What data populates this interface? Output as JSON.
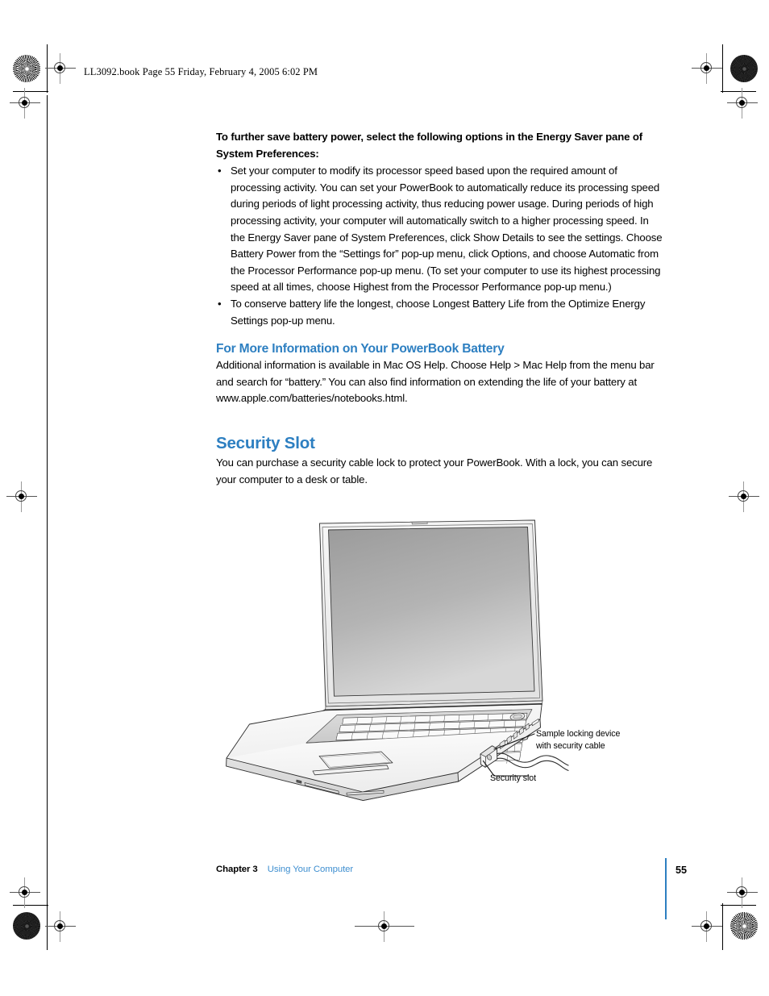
{
  "slug": {
    "text": "LL3092.book  Page 55  Friday, February 4, 2005  6:02 PM"
  },
  "content": {
    "lead_paragraph": "To further save battery power, select the following options in the Energy Saver pane of System Preferences:",
    "bullet_marker": "•",
    "bullets": [
      "Set your computer to modify its processor speed based upon the required amount of processing activity. You can set your PowerBook to automatically reduce its processing speed during periods of light processing activity, thus reducing power usage. During periods of high processing activity, your computer will automatically switch to a higher processing speed. In the Energy Saver pane of System Preferences, click Show Details to see the settings. Choose Battery Power from the “Settings for” pop-up menu, click Options, and choose Automatic from the Processor Performance pop-up menu. (To set your computer to use its highest processing speed at all times, choose Highest from the Processor Performance pop-up menu.)",
      "To conserve battery life the longest, choose Longest Battery Life from the Optimize Energy Settings pop-up menu."
    ],
    "subhead": "For More Information on Your PowerBook Battery",
    "subhead_body": "Additional information is available in Mac OS Help. Choose Help > Mac Help from the menu bar and search for “battery.” You can also find information on extending the life of your battery at www.apple.com/batteries/notebooks.html.",
    "section_heading": "Security Slot",
    "section_body": "You can purchase a security cable lock to protect your PowerBook. With a lock, you can secure your computer to a desk or table."
  },
  "figure": {
    "callout_lock_line1": "Sample locking device",
    "callout_lock_line2": "with security cable",
    "callout_slot": "Security slot"
  },
  "footer": {
    "chapter": "Chapter 3",
    "chapter_title": "Using Your Computer",
    "page_number": "55"
  },
  "colors": {
    "heading_blue": "#2d7fc1",
    "footer_link_blue": "#3f8fd0",
    "text_black": "#000000"
  }
}
